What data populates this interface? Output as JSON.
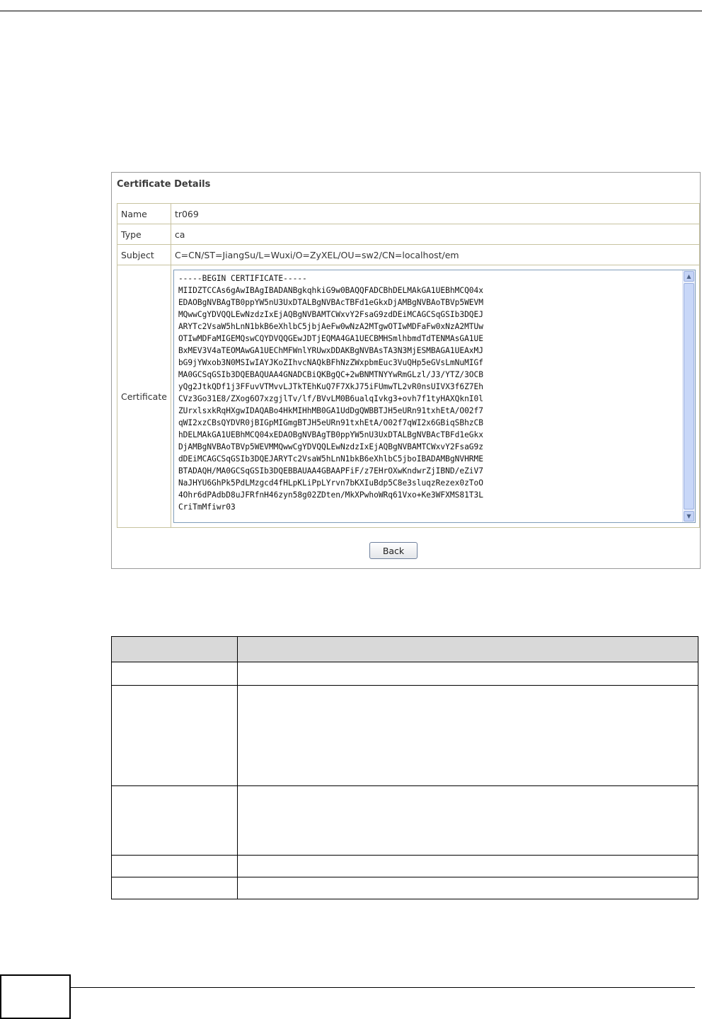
{
  "panel": {
    "title": "Certificate Details",
    "rows": [
      {
        "label": "Name",
        "value": "tr069"
      },
      {
        "label": "Type",
        "value": "ca"
      },
      {
        "label": "Subject",
        "value": "C=CN/ST=JiangSu/L=Wuxi/O=ZyXEL/OU=sw2/CN=localhost/em"
      }
    ],
    "certificate_label": "Certificate",
    "certificate_text": "-----BEGIN CERTIFICATE-----\nMIIDZTCCAs6gAwIBAgIBADANBgkqhkiG9w0BAQQFADCBhDELMAkGA1UEBhMCQ04x\nEDAOBgNVBAgTB0ppYW5nU3UxDTALBgNVBAcTBFd1eGkxDjAMBgNVBAoTBVp5WEVM\nMQwwCgYDVQQLEwNzdzIxEjAQBgNVBAMTCWxvY2FsaG9zdDEiMCAGCSqGSIb3DQEJ\nARYTc2VsaW5hLnN1bkB6eXhlbC5jbjAeFw0wNzA2MTgwOTIwMDFaFw0xNzA2MTUw\nOTIwMDFaMIGEMQswCQYDVQQGEwJDTjEQMA4GA1UECBMHSmlhbmdTdTENMAsGA1UE\nBxMEV3V4aTEOMAwGA1UEChMFWnlYRUwxDDAKBgNVBAsTA3N3MjESMBAGA1UEAxMJ\nbG9jYWxob3N0MSIwIAYJKoZIhvcNAQkBFhNzZWxpbmEuc3VuQHp5eGVsLmNuMIGf\nMA0GCSqGSIb3DQEBAQUAA4GNADCBiQKBgQC+2wBNMTNYYwRmGLzl/J3/YTZ/3OCB\nyQg2JtkQDf1j3FFuvVTMvvLJTkTEhKuQ7F7XkJ75iFUmwTL2vR0nsUIVX3f6Z7Eh\nCVz3Go31E8/ZXog6O7xzgjlTv/lf/BVvLM0B6ualqIvkg3+ovh7f1tyHAXQknI0l\nZUrxlsxkRqHXgwIDAQABo4HkMIHhMB0GA1UdDgQWBBTJH5eURn91txhEtA/O02f7\nqWI2xzCBsQYDVR0jBIGpMIGmgBTJH5eURn91txhEtA/O02f7qWI2x6GBiqSBhzCB\nhDELMAkGA1UEBhMCQ04xEDAOBgNVBAgTB0ppYW5nU3UxDTALBgNVBAcTBFd1eGkx\nDjAMBgNVBAoTBVp5WEVMMQwwCgYDVQQLEwNzdzIxEjAQBgNVBAMTCWxvY2FsaG9z\ndDEiMCAGCSqGSIb3DQEJARYTc2VsaW5hLnN1bkB6eXhlbC5jboIBADAMBgNVHRME\nBTADAQH/MA0GCSqGSIb3DQEBBAUAA4GBAAPFiF/z7EHrOXwKndwrZjIBND/eZiV7\nNaJHYU6GhPk5PdLMzgcd4fHLpKLiPpLYrvn7bKXIuBdp5C8e3sluqzRezex0zToO\n4Ohr6dPAdbD8uJFRfnH46zyn58g02ZDten/MkXPwhoWRq61Vxo+Ke3WFXMS81T3L\nCriTmMfiwr03",
    "back_label": "Back"
  }
}
